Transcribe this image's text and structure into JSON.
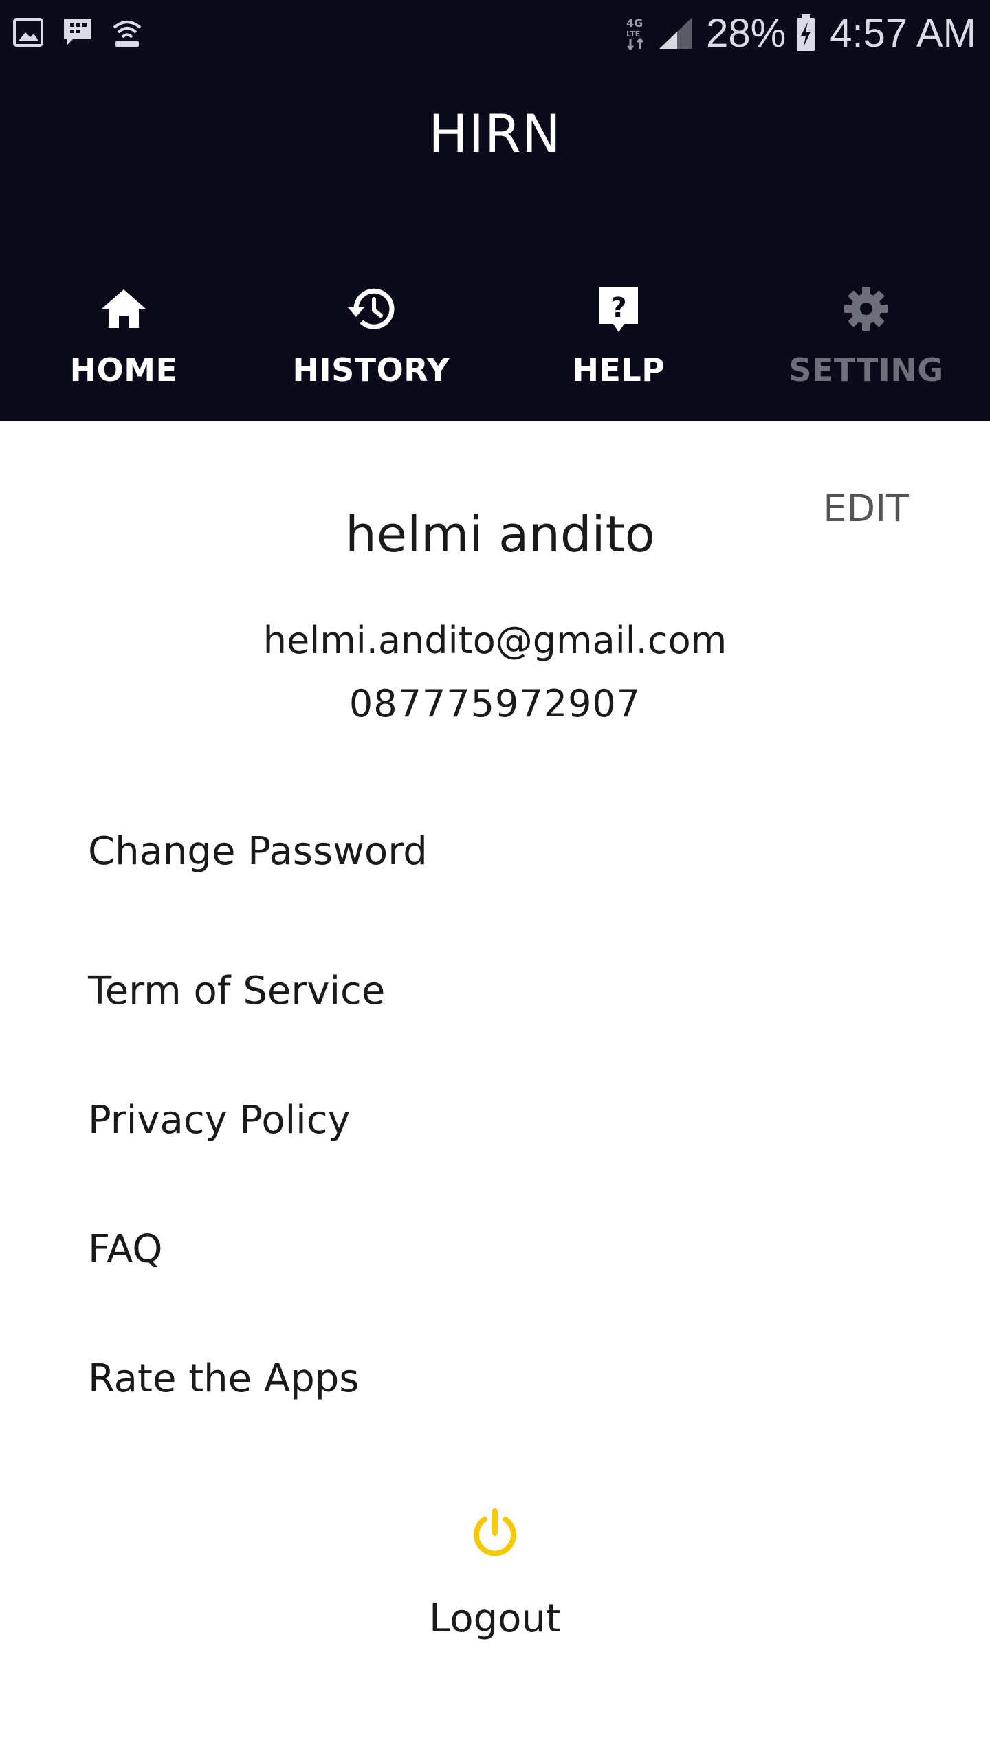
{
  "status_bar": {
    "icons_left": [
      "gallery-icon",
      "bbm-icon",
      "hotspot-icon"
    ],
    "network": "4G LTE",
    "battery_percent": "28%",
    "time": "4:57 AM"
  },
  "app": {
    "title": "HIRN"
  },
  "tabs": [
    {
      "label": "HOME",
      "icon": "home-icon",
      "active": false
    },
    {
      "label": "HISTORY",
      "icon": "history-icon",
      "active": false
    },
    {
      "label": "HELP",
      "icon": "help-icon",
      "active": false
    },
    {
      "label": "SETTING",
      "icon": "gear-icon",
      "active": true
    }
  ],
  "profile": {
    "edit_label": "EDIT",
    "name": "helmi andito",
    "email": "helmi.andito@gmail.com",
    "phone": "087775972907"
  },
  "menu": [
    {
      "label": "Change Password"
    },
    {
      "label": "Term of Service"
    },
    {
      "label": "Privacy Policy"
    },
    {
      "label": "FAQ"
    },
    {
      "label": "Rate the Apps"
    }
  ],
  "logout": {
    "label": "Logout",
    "icon": "power-icon"
  },
  "colors": {
    "header_bg": "#0b0a1a",
    "accent": "#f5c800",
    "inactive_tab": "#6e6f7a"
  }
}
